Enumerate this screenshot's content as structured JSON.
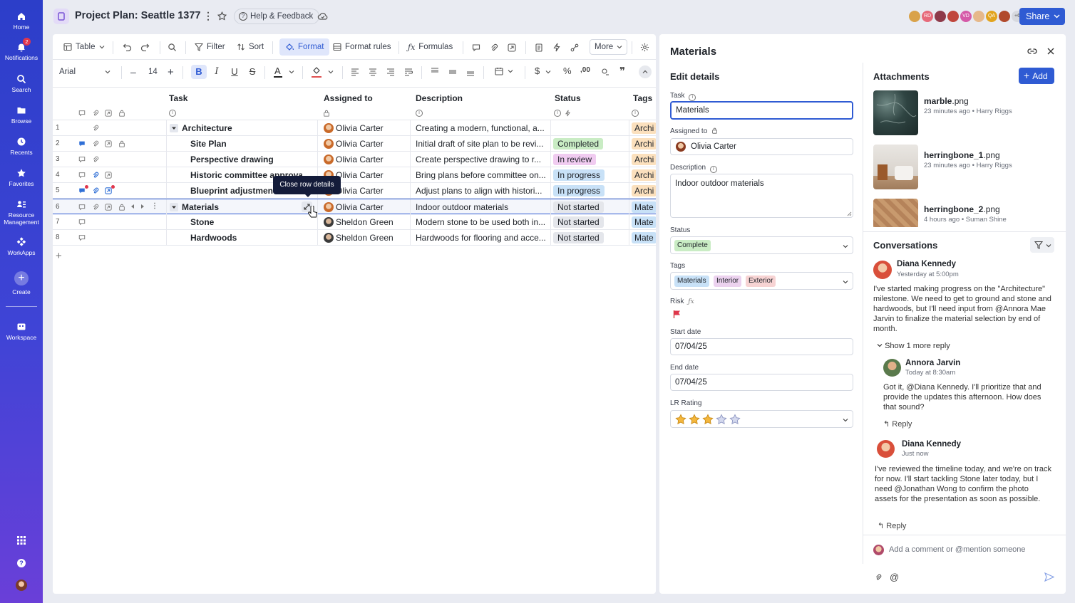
{
  "rail": {
    "items": [
      {
        "label": "Home",
        "icon": "home-icon"
      },
      {
        "label": "Notifications",
        "icon": "bell-icon",
        "badge": "2"
      },
      {
        "label": "Search",
        "icon": "search-icon"
      },
      {
        "label": "Browse",
        "icon": "folder-icon"
      },
      {
        "label": "Recents",
        "icon": "clock-icon"
      },
      {
        "label": "Favorites",
        "icon": "star-icon"
      },
      {
        "label": "Resource Management",
        "icon": "people-icon"
      },
      {
        "label": "WorkApps",
        "icon": "workapps-icon"
      },
      {
        "label": "Create",
        "icon": "plus-icon"
      },
      {
        "label": "Workspace",
        "icon": "workspace-icon"
      }
    ]
  },
  "topbar": {
    "title": "Project Plan: Seattle 1377",
    "help": "Help & Feedback",
    "collaborators": [
      "",
      "RD",
      "",
      "",
      "VD",
      "",
      "QA",
      "",
      "+6"
    ],
    "share": "Share"
  },
  "toolbar": {
    "view": "Table",
    "filter": "Filter",
    "sort": "Sort",
    "format": "Format",
    "format_rules": "Format rules",
    "formulas": "Formulas",
    "more": "More",
    "font": "Arial",
    "font_size": "14"
  },
  "tooltip": "Close row details",
  "columns": {
    "task": "Task",
    "assigned": "Assigned to",
    "description": "Description",
    "status": "Status",
    "tags": "Tags"
  },
  "rows": [
    {
      "num": "1",
      "task": "Architecture",
      "assigned": "Olivia Carter",
      "desc": "Creating a modern, functional, a...",
      "status": "",
      "tag": "Archi",
      "parent": true
    },
    {
      "num": "2",
      "task": "Site Plan",
      "assigned": "Olivia Carter",
      "desc": "Initial draft of site plan to be revi...",
      "status": "Completed",
      "tag": "Archi"
    },
    {
      "num": "3",
      "task": "Perspective drawing",
      "assigned": "Olivia Carter",
      "desc": "Create perspective drawing to r...",
      "status": "In review",
      "tag": "Archi"
    },
    {
      "num": "4",
      "task": "Historic committee approval",
      "assigned": "Olivia Carter",
      "desc": "Bring plans before committee on...",
      "status": "In progress",
      "tag": "Archi"
    },
    {
      "num": "5",
      "task": "Blueprint adjustments",
      "assigned": "Olivia Carter",
      "desc": "Adjust plans to align with histori...",
      "status": "In progress",
      "tag": "Archi"
    },
    {
      "num": "6",
      "task": "Materials",
      "assigned": "Olivia Carter",
      "desc": "Indoor outdoor materials",
      "status": "Not started",
      "tag": "Mate",
      "parent": true
    },
    {
      "num": "7",
      "task": "Stone",
      "assigned": "Sheldon Green",
      "desc": "Modern stone to be used both in...",
      "status": "Not started",
      "tag": "Mate"
    },
    {
      "num": "8",
      "task": "Hardwoods",
      "assigned": "Sheldon Green",
      "desc": "Hardwoods for flooring and acce...",
      "status": "Not started",
      "tag": "Mate"
    }
  ],
  "status_colors": {
    "Completed": "#c9ecc4",
    "In review": "#f0cbf0",
    "In progress": "#c8e1f7",
    "Not started": "#e4e6eb"
  },
  "panel": {
    "title": "Materials",
    "edit_title": "Edit details",
    "task_label": "Task",
    "task_value": "Materials",
    "assigned_label": "Assigned to",
    "assigned_value": "Olivia Carter",
    "description_label": "Description",
    "description_value": "Indoor outdoor materials",
    "status_label": "Status",
    "status_value": "Complete",
    "tags_label": "Tags",
    "tags": [
      "Materials",
      "Interior",
      "Exterior"
    ],
    "risk_label": "Risk",
    "start_label": "Start date",
    "start_value": "07/04/25",
    "end_label": "End date",
    "end_value": "07/04/25",
    "rating_label": "LR Rating",
    "rating": 3,
    "rating_max": 5
  },
  "attachments": {
    "title": "Attachments",
    "add": "Add",
    "files": [
      {
        "name": "marble",
        "ext": ".png",
        "meta": "23 minutes ago • Harry Riggs"
      },
      {
        "name": "herringbone_1",
        "ext": ".png",
        "meta": "23 minutes ago • Harry Riggs"
      },
      {
        "name": "herringbone_2",
        "ext": ".png",
        "meta": "4 hours ago • Suman Shine"
      }
    ]
  },
  "conversations": {
    "title": "Conversations",
    "c1_author": "Diana Kennedy",
    "c1_time": "Yesterday at 5:00pm",
    "c1_text": "I've started making progress on the \"Architecture\" milestone. We need to get to ground and stone and hardwoods, but I'll need input from @Annora Mae Jarvin to finalize the material selection by end of month.",
    "show_more": "Show 1 more reply",
    "r1_author": "Annora Jarvin",
    "r1_time": "Today at 8:30am",
    "r1_text": "Got it, @Diana Kennedy. I'll prioritize that and provide the updates this afternoon. How does that sound?",
    "reply": "Reply",
    "c2_author": "Diana Kennedy",
    "c2_time": "Just now",
    "c2_text": "I've reviewed the timeline today, and we're on track for now. I'll start tackling Stone later today, but I need @Jonathan Wong to confirm the photo assets for the presentation as soon as possible.",
    "comment_placeholder": "Add a comment or @mention someone"
  }
}
